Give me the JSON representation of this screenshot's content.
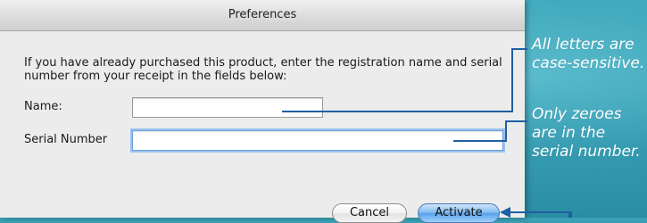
{
  "window": {
    "title": "Preferences"
  },
  "dialog": {
    "instructions": "If you have already purchased this product, enter the registration name and serial number from your receipt in the fields below:",
    "name_label": "Name:",
    "name_value": "",
    "serial_label": "Serial Number",
    "serial_value": "",
    "cancel_label": "Cancel",
    "activate_label": "Activate"
  },
  "callouts": {
    "name_note": "All letters are case-sensitive.",
    "serial_note": "Only zeroes are in the serial number."
  },
  "colors": {
    "background": "#3aa0b4",
    "callout_line": "#1f5fa3",
    "default_button": "#5aa2ea"
  }
}
